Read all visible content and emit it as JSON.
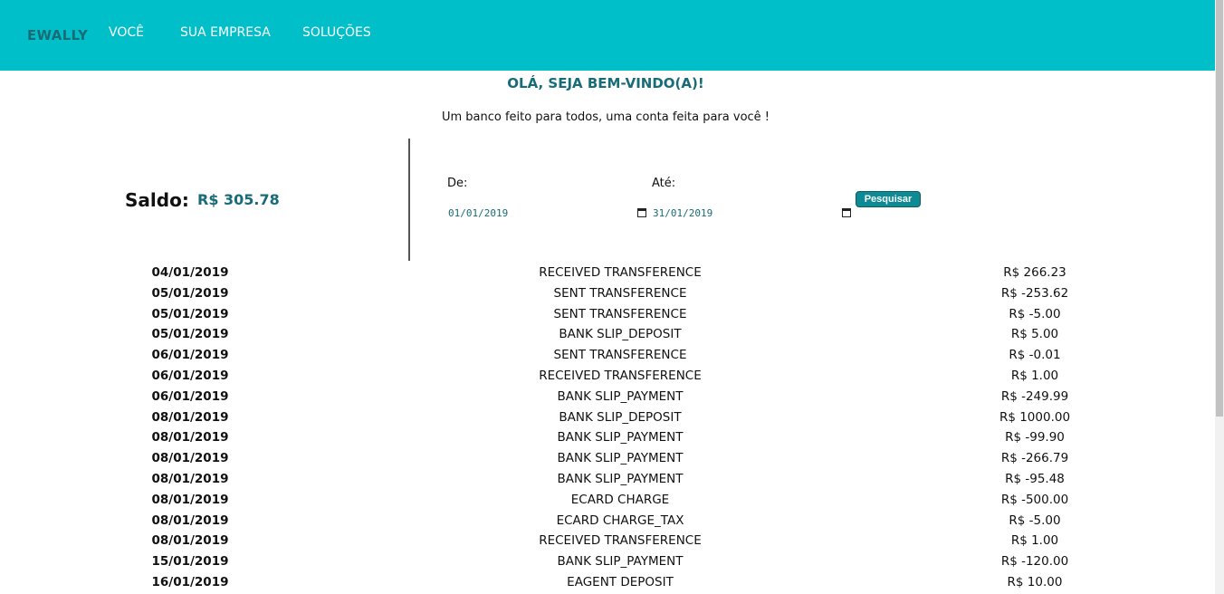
{
  "navbar": {
    "brand": "EWALLY",
    "links": [
      {
        "label": "VOCÊ"
      },
      {
        "label": "SUA EMPRESA"
      },
      {
        "label": "SOLUÇÕES"
      }
    ],
    "color": "#00bfc8"
  },
  "welcome": {
    "title": "OLÁ, SEJA BEM-VINDO(A)!",
    "subtitle": "Um banco feito para todos, uma conta feita para você !"
  },
  "balance": {
    "label": "Saldo:",
    "value": "R$ 305.78"
  },
  "filter": {
    "from_label": "De:",
    "from_value": "01/01/2019",
    "to_label": "Até:",
    "to_value": "31/01/2019",
    "search_label": "Pesquisar"
  },
  "transactions": [
    {
      "date": "04/01/2019",
      "description": "RECEIVED TRANSFERENCE",
      "amount": "R$ 266.23"
    },
    {
      "date": "05/01/2019",
      "description": "SENT TRANSFERENCE",
      "amount": "R$ -253.62"
    },
    {
      "date": "05/01/2019",
      "description": "SENT TRANSFERENCE",
      "amount": "R$ -5.00"
    },
    {
      "date": "05/01/2019",
      "description": "BANK SLIP_DEPOSIT",
      "amount": "R$ 5.00"
    },
    {
      "date": "06/01/2019",
      "description": "SENT TRANSFERENCE",
      "amount": "R$ -0.01"
    },
    {
      "date": "06/01/2019",
      "description": "RECEIVED TRANSFERENCE",
      "amount": "R$ 1.00"
    },
    {
      "date": "06/01/2019",
      "description": "BANK SLIP_PAYMENT",
      "amount": "R$ -249.99"
    },
    {
      "date": "08/01/2019",
      "description": "BANK SLIP_DEPOSIT",
      "amount": "R$ 1000.00"
    },
    {
      "date": "08/01/2019",
      "description": "BANK SLIP_PAYMENT",
      "amount": "R$ -99.90"
    },
    {
      "date": "08/01/2019",
      "description": "BANK SLIP_PAYMENT",
      "amount": "R$ -266.79"
    },
    {
      "date": "08/01/2019",
      "description": "BANK SLIP_PAYMENT",
      "amount": "R$ -95.48"
    },
    {
      "date": "08/01/2019",
      "description": "ECARD CHARGE",
      "amount": "R$ -500.00"
    },
    {
      "date": "08/01/2019",
      "description": "ECARD CHARGE_TAX",
      "amount": "R$ -5.00"
    },
    {
      "date": "08/01/2019",
      "description": "RECEIVED TRANSFERENCE",
      "amount": "R$ 1.00"
    },
    {
      "date": "15/01/2019",
      "description": "BANK SLIP_PAYMENT",
      "amount": "R$ -120.00"
    },
    {
      "date": "16/01/2019",
      "description": "EAGENT DEPOSIT",
      "amount": "R$ 10.00"
    }
  ]
}
